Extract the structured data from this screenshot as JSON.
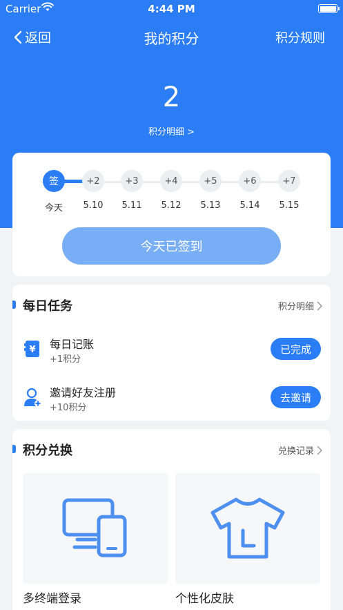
{
  "colors": {
    "accent": "#2a7df5",
    "button_disabled": "#78aef5",
    "background": "#f2f3f5"
  },
  "status_bar": {
    "carrier": "Carrier",
    "time": "4:44 PM"
  },
  "nav": {
    "back_label": "返回",
    "title": "我的积分",
    "rules_label": "积分规则"
  },
  "points": {
    "value": "2",
    "detail_link": "积分明细 >"
  },
  "sign_in": {
    "steps": [
      {
        "badge": "签",
        "date": "今天",
        "checked": true
      },
      {
        "badge": "+2",
        "date": "5.10",
        "checked": false
      },
      {
        "badge": "+3",
        "date": "5.11",
        "checked": false
      },
      {
        "badge": "+4",
        "date": "5.12",
        "checked": false
      },
      {
        "badge": "+5",
        "date": "5.13",
        "checked": false
      },
      {
        "badge": "+6",
        "date": "5.14",
        "checked": false
      },
      {
        "badge": "+7",
        "date": "5.15",
        "checked": false
      }
    ],
    "button_label": "今天已签到"
  },
  "daily_tasks": {
    "title": "每日任务",
    "link": "积分明细",
    "items": [
      {
        "icon": "ledger-yen-icon",
        "name": "每日记账",
        "reward": "+1积分",
        "button": "已完成"
      },
      {
        "icon": "invite-user-icon",
        "name": "邀请好友注册",
        "reward": "+10积分",
        "button": "去邀请"
      }
    ]
  },
  "exchange": {
    "title": "积分兑换",
    "link": "兑换记录",
    "items": [
      {
        "icon": "multi-device-icon",
        "label": "多终端登录"
      },
      {
        "icon": "tshirt-icon",
        "label": "个性化皮肤"
      }
    ]
  }
}
